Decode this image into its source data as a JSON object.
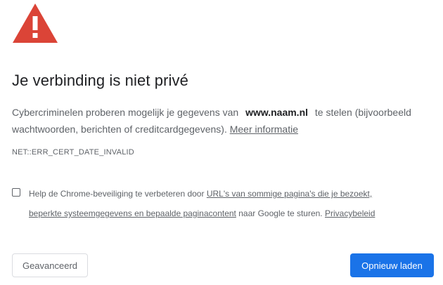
{
  "icon": {
    "name": "warning-triangle-icon",
    "color": "#db4437"
  },
  "heading": "Je verbinding is niet privé",
  "intro": {
    "before_host": "Cybercriminelen proberen mogelijk je gegevens van",
    "host": "www.naam.nl",
    "after_host": "te stelen (bijvoorbeeld wachtwoorden, berichten of creditcardgegevens).",
    "learn_more_link": "Meer informatie"
  },
  "error_code": "NET::ERR_CERT_DATE_INVALID",
  "optin": {
    "checked": false,
    "text_start": "Help de Chrome-beveiliging te verbeteren door",
    "link_urls": "URL's van sommige pagina's die je bezoekt,",
    "link_system_info": "beperkte systeemgegevens en bepaalde paginacontent",
    "text_middle": "naar Google te sturen.",
    "link_privacy": "Privacybeleid"
  },
  "buttons": {
    "advanced_label": "Geavanceerd",
    "reload_label": "Opnieuw laden"
  },
  "colors": {
    "primary": "#1a73e8",
    "warning": "#db4437",
    "text_secondary": "#5f6368"
  }
}
